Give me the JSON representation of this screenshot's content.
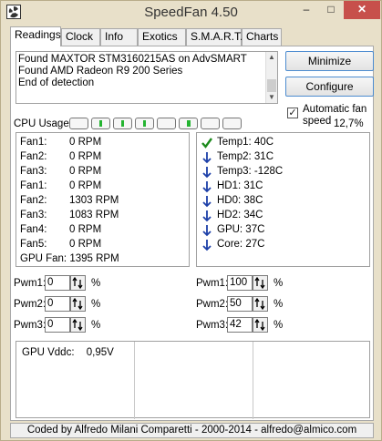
{
  "window": {
    "title": "SpeedFan 4.50"
  },
  "titlebar": {
    "min_glyph": "–",
    "max_glyph": "□",
    "close_glyph": "✕"
  },
  "tabs": [
    {
      "label": "Readings",
      "active": true
    },
    {
      "label": "Clock"
    },
    {
      "label": "Info"
    },
    {
      "label": "Exotics"
    },
    {
      "label": "S.M.A.R.T."
    },
    {
      "label": "Charts"
    }
  ],
  "log": {
    "lines": [
      "Found MAXTOR STM3160215AS on AdvSMART",
      "Found AMD Radeon R9 200 Series",
      "End of detection"
    ]
  },
  "buttons": {
    "minimize": "Minimize",
    "configure": "Configure"
  },
  "auto_fan": {
    "label": "Automatic fan speed",
    "checked": true,
    "check_glyph": "✓"
  },
  "cpu_usage": {
    "label": "CPU Usage",
    "percent_text": "12,7%",
    "cores_active": [
      false,
      true,
      true,
      true,
      true,
      false,
      false,
      false
    ],
    "accent_color": "#24b431"
  },
  "fans": [
    {
      "name": "Fan1:",
      "value": "0 RPM"
    },
    {
      "name": "Fan2:",
      "value": "0 RPM"
    },
    {
      "name": "Fan3:",
      "value": "0 RPM"
    },
    {
      "name": "Fan1:",
      "value": "0 RPM"
    },
    {
      "name": "Fan2:",
      "value": "1303 RPM"
    },
    {
      "name": "Fan3:",
      "value": "1083 RPM"
    },
    {
      "name": "Fan4:",
      "value": "0 RPM"
    },
    {
      "name": "Fan5:",
      "value": "0 RPM"
    }
  ],
  "gpu_fan": "GPU Fan: 1395 RPM",
  "temps": [
    {
      "text": "Temp1: 40C",
      "icon": "check-icon",
      "color": "#1c8a1c"
    },
    {
      "text": "Temp2: 31C",
      "icon": "arrow-down-icon",
      "color": "#1c3fa8"
    },
    {
      "text": "Temp3: -128C",
      "icon": "arrow-down-icon",
      "color": "#1c3fa8"
    },
    {
      "text": "HD1:   31C",
      "icon": "arrow-down-icon",
      "color": "#1c3fa8"
    },
    {
      "text": "HD0:   38C",
      "icon": "arrow-down-icon",
      "color": "#1c3fa8"
    },
    {
      "text": "HD2:   34C",
      "icon": "arrow-down-icon",
      "color": "#1c3fa8"
    },
    {
      "text": "GPU:   37C",
      "icon": "arrow-down-icon",
      "color": "#1c3fa8"
    },
    {
      "text": "Core:  27C",
      "icon": "arrow-down-icon",
      "color": "#1c3fa8"
    }
  ],
  "pwm_left": [
    {
      "label": "Pwm1:",
      "value": "0",
      "unit": "%"
    },
    {
      "label": "Pwm2:",
      "value": "0",
      "unit": "%"
    },
    {
      "label": "Pwm3:",
      "value": "0",
      "unit": "%"
    }
  ],
  "pwm_right": [
    {
      "label": "Pwm1:",
      "value": "100",
      "unit": "%"
    },
    {
      "label": "Pwm2:",
      "value": "50",
      "unit": "%"
    },
    {
      "label": "Pwm3:",
      "value": "42",
      "unit": "%"
    }
  ],
  "gpu_vddc": {
    "label": "GPU Vddc:",
    "value": "0,95V"
  },
  "status": "Coded by Alfredo Milani Comparetti - 2000-2014 - alfredo@almico.com"
}
